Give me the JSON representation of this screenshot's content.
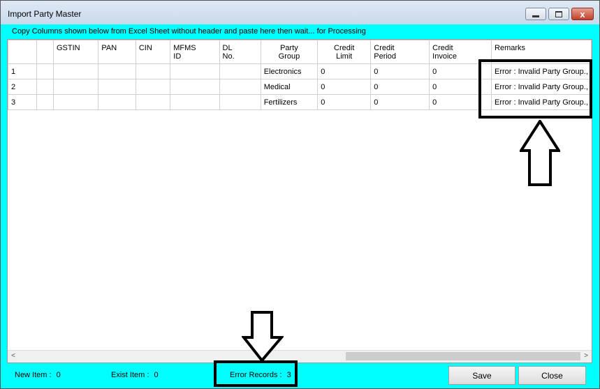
{
  "window": {
    "title": "Import Party Master",
    "min_icon": "minimize-icon",
    "max_icon": "maximize-icon",
    "close_icon": "close-icon",
    "close_glyph": "x"
  },
  "instructions": "Copy Columns shown below from Excel Sheet without header and paste here then wait... for Processing",
  "grid": {
    "columns": [
      "",
      "",
      "GSTIN",
      "PAN",
      "CIN",
      "MFMS ID",
      "DL No.",
      "Party Group",
      "Credit Limit",
      "Credit Period",
      "Credit Invoice",
      "Remarks"
    ],
    "column_lines": [
      [
        ""
      ],
      [
        ""
      ],
      [
        "GSTIN"
      ],
      [
        "PAN"
      ],
      [
        "CIN"
      ],
      [
        "MFMS",
        "ID"
      ],
      [
        "DL",
        "No."
      ],
      [
        "Party",
        "Group"
      ],
      [
        "Credit",
        "Limit"
      ],
      [
        "Credit",
        "Period"
      ],
      [
        "Credit",
        "Invoice"
      ],
      [
        "Remarks"
      ]
    ],
    "rows": [
      [
        "1",
        "",
        "",
        "",
        "",
        "",
        "",
        "Electronics",
        "0",
        "0",
        "0",
        "Error : Invalid Party Group.,"
      ],
      [
        "2",
        "",
        "",
        "",
        "",
        "",
        "",
        "Medical",
        "0",
        "0",
        "0",
        "Error : Invalid Party Group.,"
      ],
      [
        "3",
        "",
        "",
        "",
        "",
        "",
        "",
        "Fertilizers",
        "0",
        "0",
        "0",
        "Error : Invalid Party Group.,"
      ]
    ],
    "scroll_left": "<",
    "scroll_right": ">"
  },
  "status": {
    "new_item_label": "New Item :",
    "new_item_value": "0",
    "exist_item_label": "Exist Item :",
    "exist_item_value": "0",
    "error_records_label": "Error Records :",
    "error_records_value": "3"
  },
  "buttons": {
    "save": "Save",
    "close": "Close"
  },
  "annotations": {
    "up_arrow_icon": "up-arrow-icon",
    "down_arrow_icon": "down-arrow-icon"
  }
}
